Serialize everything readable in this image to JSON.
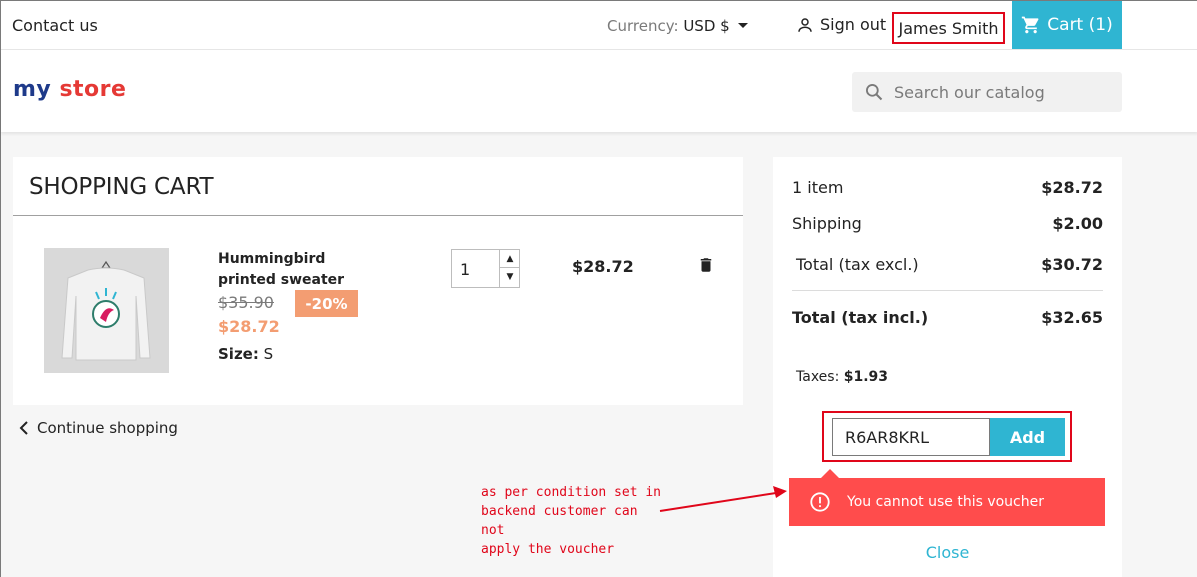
{
  "topbar": {
    "contact": "Contact us",
    "currency_label": "Currency:",
    "currency_value": "USD $",
    "signout": "Sign out",
    "user_name": "James Smith",
    "cart": "Cart (1)"
  },
  "header": {
    "logo": {
      "w1": "my",
      "w2": "store"
    },
    "search_placeholder": "Search our catalog"
  },
  "cart": {
    "title": "SHOPPING CART",
    "item": {
      "name": "Hummingbird printed sweater",
      "old_price": "$35.90",
      "discount": "-20%",
      "new_price": "$28.72",
      "size_label": "Size:",
      "size_value": "S",
      "quantity": "1",
      "line_total": "$28.72"
    },
    "continue": "Continue shopping"
  },
  "summary": {
    "items_label": "1 item",
    "items_amount": "$28.72",
    "shipping_label": "Shipping",
    "shipping_amount": "$2.00",
    "total_excl_label": "Total (tax excl.)",
    "total_excl_amount": "$30.72",
    "total_incl_label": "Total (tax incl.)",
    "total_incl_amount": "$32.65",
    "taxes_label": "Taxes:",
    "taxes_amount": "$1.93",
    "voucher_code": "R6AR8KRL",
    "add_label": "Add",
    "error": "You cannot use this voucher",
    "close": "Close"
  },
  "annotation": {
    "line1": "as per condition set in",
    "line2": "backend customer can not",
    "line3": "apply the voucher"
  },
  "colors": {
    "accent": "#2fb5d2",
    "error": "#ff4c4c",
    "discount": "#f39d72",
    "highlight_border": "#e0061a"
  }
}
